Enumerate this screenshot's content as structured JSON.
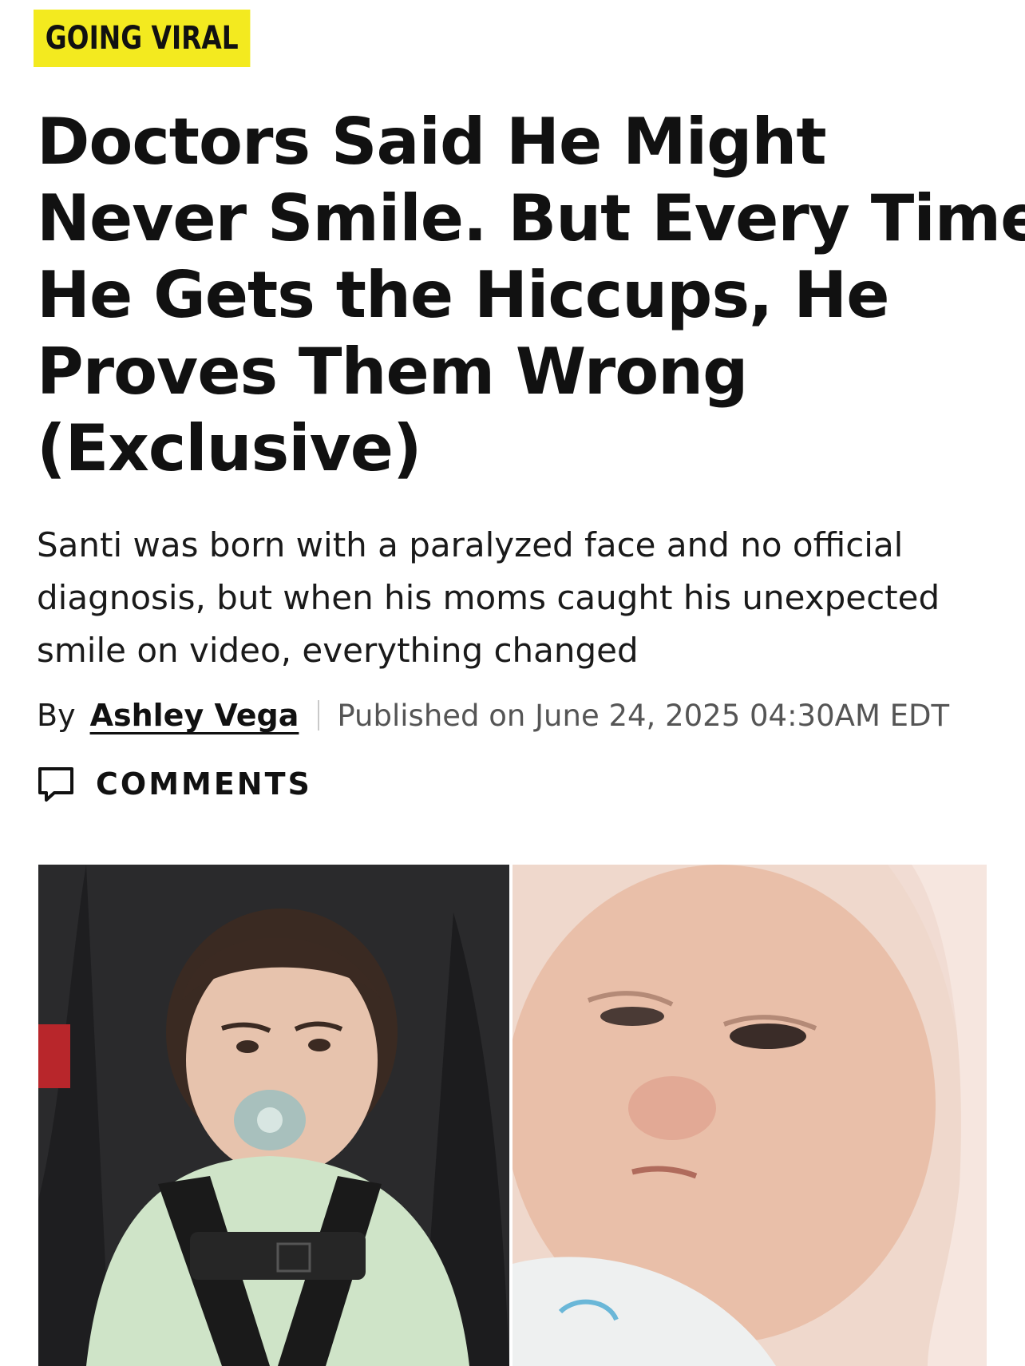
{
  "article": {
    "kicker": "GOING VIRAL",
    "headline_lines": [
      "Doctors Said He Might",
      "Never Smile. But Every Time",
      "He Gets the Hiccups, He",
      "Proves Them Wrong",
      "(Exclusive)"
    ],
    "dek_lines": [
      "Santi was born with a paralyzed face and no official",
      "diagnosis, but when his moms caught his unexpected",
      "smile on video, everything changed"
    ],
    "byline": {
      "prefix": "By",
      "author": "Ashley Vega",
      "published": "Published on June 24, 2025 04:30AM EDT"
    },
    "comments_label": "COMMENTS",
    "icons": {
      "comments": "comment-bubble-icon"
    },
    "colors": {
      "kicker_bg": "#f3ea1f",
      "text": "#111111",
      "meta": "#555555"
    }
  }
}
